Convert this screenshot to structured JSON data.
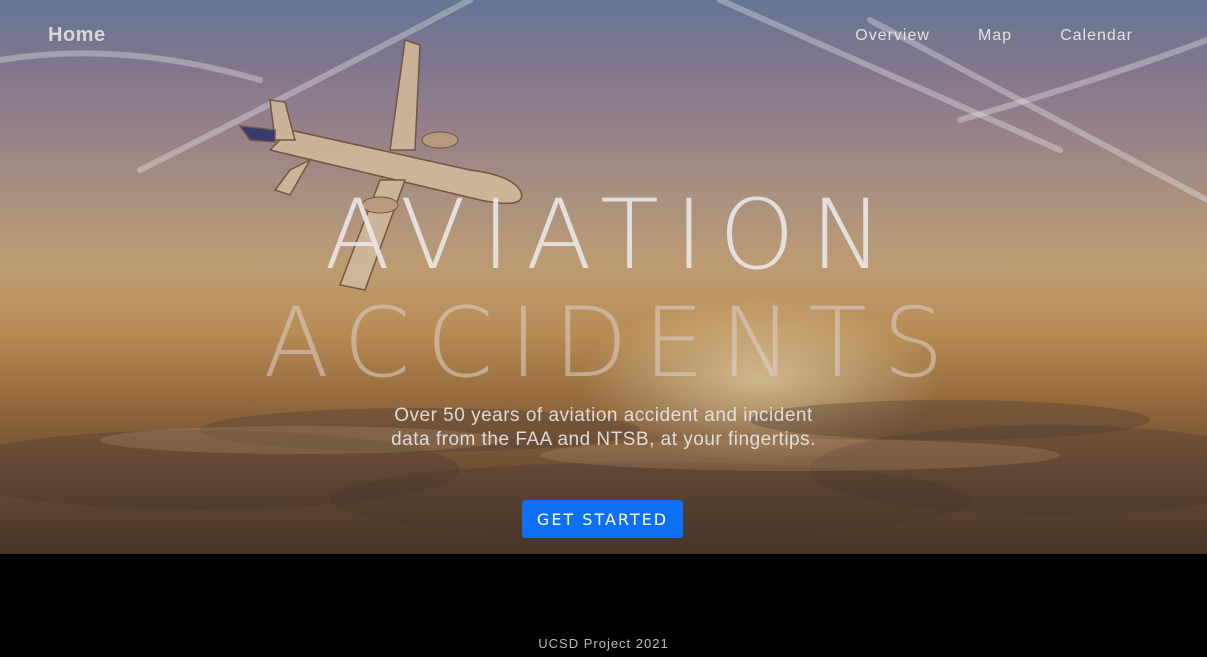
{
  "nav": {
    "home": "Home",
    "links": [
      "Overview",
      "Map",
      "Calendar"
    ]
  },
  "hero": {
    "title_line1": "AVIATION",
    "title_line2": "ACCIDENTS",
    "subtitle_line1": "Over 50 years of aviation accident and incident",
    "subtitle_line2": "data from the FAA and NTSB, at your fingertips.",
    "cta_label": "GET STARTED",
    "background_image": "airplane-above-clouds-at-sunset"
  },
  "footer": {
    "text": "UCSD Project 2021"
  },
  "colors": {
    "cta": "#0f6ff6",
    "footer_bg": "#000000"
  }
}
